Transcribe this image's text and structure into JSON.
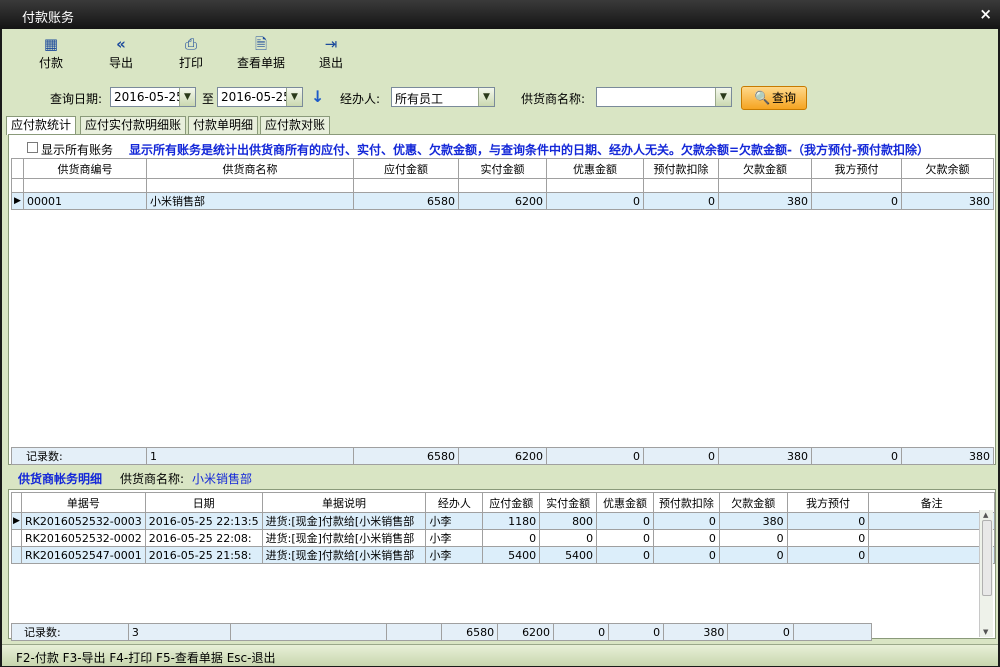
{
  "window": {
    "title": "付款账务",
    "close": "×"
  },
  "toolbar": [
    {
      "label": "付款",
      "icon": "calendar-icon"
    },
    {
      "label": "导出",
      "icon": "double-chevron-left-icon"
    },
    {
      "label": "打印",
      "icon": "printer-icon"
    },
    {
      "label": "查看单据",
      "icon": "document-search-icon"
    },
    {
      "label": "退出",
      "icon": "exit-door-icon"
    }
  ],
  "query": {
    "date_label": "查询日期:",
    "date_from": "2016-05-25",
    "to_label": "至",
    "date_to": "2016-05-25",
    "handler_label": "经办人:",
    "handler_value": "所有员工",
    "supplier_label": "供货商名称:",
    "supplier_value": "",
    "search_label": "查询"
  },
  "tabs": [
    "应付款统计",
    "应付实付款明细账",
    "付款单明细",
    "应付款对账"
  ],
  "summary": {
    "checkbox_label": "显示所有账务",
    "notice": "显示所有账务是统计出供货商所有的应付、实付、优惠、欠款金额，与查询条件中的日期、经办人无关。欠款余额=欠款金额-（我方预付-预付款扣除）",
    "columns": [
      "供货商编号",
      "供货商名称",
      "应付金额",
      "实付金额",
      "优惠金额",
      "预付款扣除",
      "欠款金额",
      "我方预付",
      "欠款余额"
    ],
    "rows": [
      {
        "code": "00001",
        "name": "小米销售部",
        "payable": "6580",
        "paid": "6200",
        "discount": "0",
        "prepay_deduct": "0",
        "debt": "380",
        "our_prepay": "0",
        "balance": "380"
      }
    ],
    "footer": {
      "label": "记录数:",
      "count": "1",
      "payable": "6580",
      "paid": "6200",
      "discount": "0",
      "prepay_deduct": "0",
      "debt": "380",
      "our_prepay": "0",
      "balance": "380"
    }
  },
  "detail": {
    "title": "供货商帐务明细",
    "supplier_label": "供货商名称:",
    "supplier_value": "小米销售部",
    "columns": [
      "单据号",
      "日期",
      "单据说明",
      "经办人",
      "应付金额",
      "实付金额",
      "优惠金额",
      "预付款扣除",
      "欠款金额",
      "我方预付",
      "备注"
    ],
    "rows": [
      {
        "no": "RK2016052532-0003",
        "date": "2016-05-25 22:13:5",
        "desc": "进货:[现金]付款给[小米销售部",
        "handler": "小李",
        "payable": "1180",
        "paid": "800",
        "discount": "0",
        "prepay_deduct": "0",
        "debt": "380",
        "our_prepay": "0",
        "remark": ""
      },
      {
        "no": "RK2016052532-0002",
        "date": "2016-05-25 22:08:",
        "desc": "进货:[现金]付款给[小米销售部",
        "handler": "小李",
        "payable": "0",
        "paid": "0",
        "discount": "0",
        "prepay_deduct": "0",
        "debt": "0",
        "our_prepay": "0",
        "remark": ""
      },
      {
        "no": "RK2016052547-0001",
        "date": "2016-05-25 21:58:",
        "desc": "进货:[现金]付款给[小米销售部",
        "handler": "小李",
        "payable": "5400",
        "paid": "5400",
        "discount": "0",
        "prepay_deduct": "0",
        "debt": "0",
        "our_prepay": "0",
        "remark": ""
      }
    ],
    "footer": {
      "label": "记录数:",
      "count": "3",
      "payable": "6580",
      "paid": "6200",
      "discount": "0",
      "prepay_deduct": "0",
      "debt": "380",
      "our_prepay": "0"
    }
  },
  "statusbar": "F2-付款 F3-导出 F4-打印 F5-查看单据 Esc-退出"
}
